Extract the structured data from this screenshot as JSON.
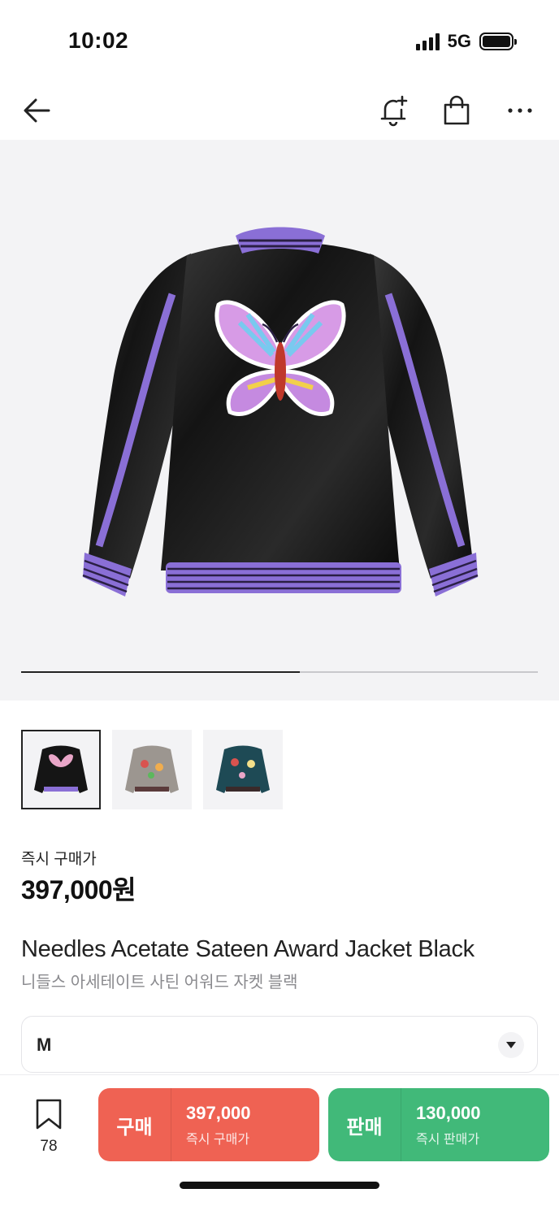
{
  "status_bar": {
    "time": "10:02",
    "network": "5G"
  },
  "product": {
    "price_label": "즉시 구매가",
    "price": "397,000원",
    "title_en": "Needles Acetate Sateen Award Jacket Black",
    "title_ko": "니들스 아세테이트 사틴 어워드 자켓 블랙",
    "image_progress": 0.54,
    "thumbnails": [
      {
        "variant": "black",
        "selected": true
      },
      {
        "variant": "silver",
        "selected": false
      },
      {
        "variant": "teal",
        "selected": false
      }
    ]
  },
  "size_select": {
    "value": "M"
  },
  "bottom_bar": {
    "wish_count": "78",
    "buy": {
      "label": "구매",
      "price": "397,000",
      "sub": "즉시 구매가",
      "color": "#ef6253"
    },
    "sell": {
      "label": "판매",
      "price": "130,000",
      "sub": "즉시 판매가",
      "color": "#41b979"
    }
  },
  "colors": {
    "accent_purple": "#8a6fd6",
    "jacket_black": "#141414"
  },
  "icons": [
    "back-arrow-icon",
    "bell-plus-icon",
    "shopping-bag-icon",
    "more-dots-icon",
    "bookmark-icon",
    "chevron-down-icon"
  ]
}
